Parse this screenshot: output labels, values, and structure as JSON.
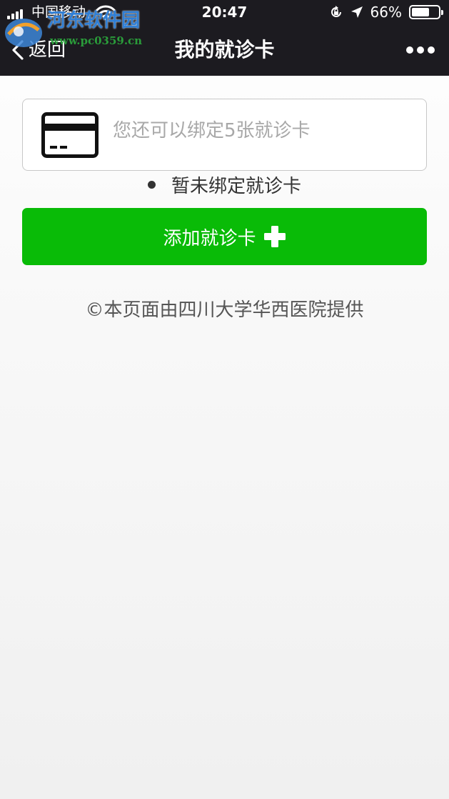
{
  "status_bar": {
    "carrier": "中国移动",
    "time": "20:47",
    "battery_percent": "66%",
    "battery_level": 0.66,
    "icons": [
      "signal-icon",
      "wifi-icon",
      "rotation-lock-icon",
      "location-icon",
      "battery-icon"
    ]
  },
  "nav": {
    "back_label": "返回",
    "title": "我的就诊卡",
    "more_icon": "more-icon"
  },
  "watermark": {
    "text": "河东软件园",
    "url": "www.pc0359.cn"
  },
  "card_box": {
    "icon": "card-icon",
    "hint": "您还可以绑定5张就诊卡"
  },
  "status_text": "暂未绑定就诊卡",
  "add_button": {
    "label": "添加就诊卡",
    "icon": "plus-icon"
  },
  "footer": "©本页面由四川大学华西医院提供",
  "colors": {
    "header_bg": "#1c1b20",
    "primary_green": "#09bb07",
    "hint_gray": "#a8a8a8"
  }
}
